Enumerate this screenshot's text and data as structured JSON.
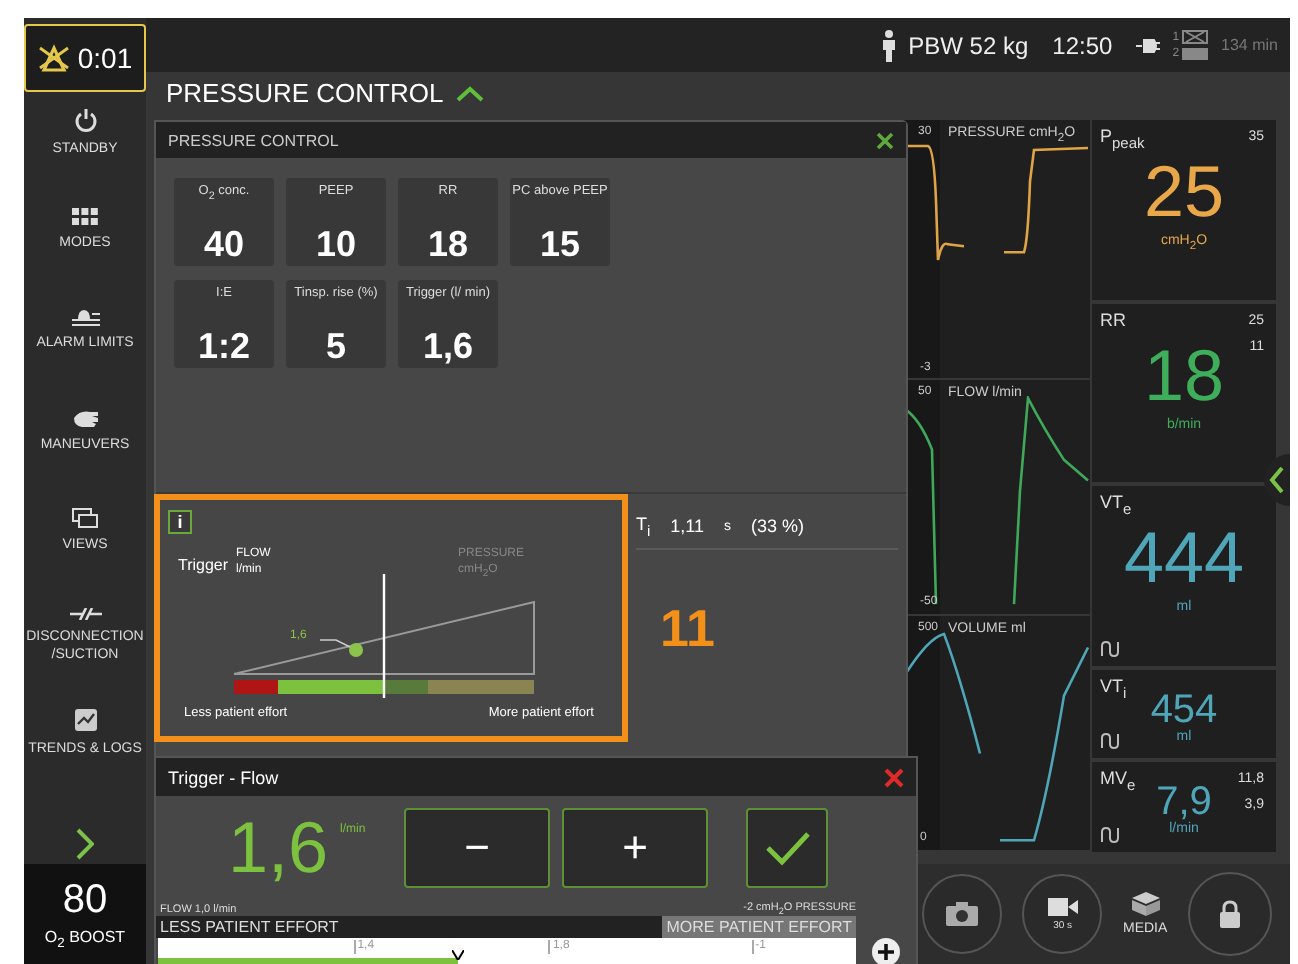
{
  "alarm_button": {
    "time": "0:01"
  },
  "top_bar": {
    "patient": "PBW 52 kg",
    "time": "12:50",
    "supply_1": "1",
    "supply_2": "2",
    "battery_time": "134 min"
  },
  "sidebar": {
    "items": [
      {
        "label": "STANDBY"
      },
      {
        "label": "MODES"
      },
      {
        "label": "ALARM LIMITS"
      },
      {
        "label": "MANEUVERS"
      },
      {
        "label": "VIEWS"
      },
      {
        "label": "DISCONNECTION /SUCTION"
      },
      {
        "label": "TRENDS & LOGS"
      }
    ]
  },
  "o2_boost": {
    "value": "80",
    "label": "O$_{2}$ BOOST"
  },
  "mode_title": "PRESSURE CONTROL",
  "mode_dialog": {
    "title": "PRESSURE CONTROL",
    "settings": [
      {
        "label": "O$_{2}$ conc.",
        "value": "40"
      },
      {
        "label": "PEEP",
        "value": "10"
      },
      {
        "label": "RR",
        "value": "18"
      },
      {
        "label": "PC above PEEP",
        "value": "15"
      },
      {
        "label": "I:E",
        "value": "1:2"
      },
      {
        "label": "Tinsp. rise (%)",
        "value": "5"
      },
      {
        "label": "Trigger (l/ min)",
        "value": "1,6"
      }
    ]
  },
  "ti": {
    "label": "T$_{i}$",
    "value": "1,11",
    "unit": "s",
    "ratio": "(33 %)"
  },
  "trigger_panel": {
    "info": "i",
    "title": "Trigger",
    "flow_label": "FLOW",
    "flow_unit": "l/min",
    "pressure_label": "PRESSURE",
    "pressure_unit": "cmH$_{2}$O",
    "point_label": "1,6",
    "level": 0.5,
    "less": "Less patient effort",
    "more": "More patient effort"
  },
  "callout": "11",
  "trigger_dialog": {
    "title": "Trigger - Flow",
    "value": "1,6",
    "unit": "l/min",
    "minus": "−",
    "plus": "+",
    "flow_limit": "FLOW 1,0 l/min",
    "pressure_limit": "-2 cmH$_{2}$O PRESSURE",
    "less": "LESS PATIENT EFFORT",
    "more": "MORE PATIENT EFFORT",
    "ticks": [
      "1,4",
      "1,8",
      "-1"
    ],
    "level": 0.43
  },
  "waveforms": [
    {
      "kind": "pressure",
      "max": "30",
      "title": "PRESSURE cmH$_{2}$O",
      "min": "-3",
      "color": "#e0a447"
    },
    {
      "kind": "flow",
      "max": "50",
      "title": "FLOW l/min",
      "min": "-50",
      "color": "#3fa85a"
    },
    {
      "kind": "volume",
      "max": "500",
      "title": "VOLUME ml",
      "min": "0",
      "color": "#4fa6b8"
    }
  ],
  "metrics": [
    {
      "kind": "large",
      "label": "P$_{peak}$",
      "value": "25",
      "unit": "cmH$_{2}$O",
      "limits": [
        "35"
      ],
      "color": "#e8a84a",
      "loop": false
    },
    {
      "kind": "large",
      "label": "RR",
      "value": "18",
      "unit": "b/min",
      "limits": [
        "25",
        "11"
      ],
      "color": "#3fae5a",
      "loop": false
    },
    {
      "kind": "large",
      "label": "VT$_{e}$",
      "value": "444",
      "unit": "ml",
      "color": "#4fa6b8",
      "loop": true
    },
    {
      "kind": "small",
      "label": "VT$_{i}$",
      "value": "454",
      "unit": "ml",
      "color": "#4fa6b8",
      "loop": true
    },
    {
      "kind": "small",
      "label": "MV$_{e}$",
      "value": "7,9",
      "unit": "l/min",
      "limits": [
        "11,8",
        "3,9"
      ],
      "color": "#4fa6b8",
      "loop": true
    }
  ],
  "bottom_bar": {
    "video_label": "30 s",
    "media_label": "MEDIA"
  }
}
